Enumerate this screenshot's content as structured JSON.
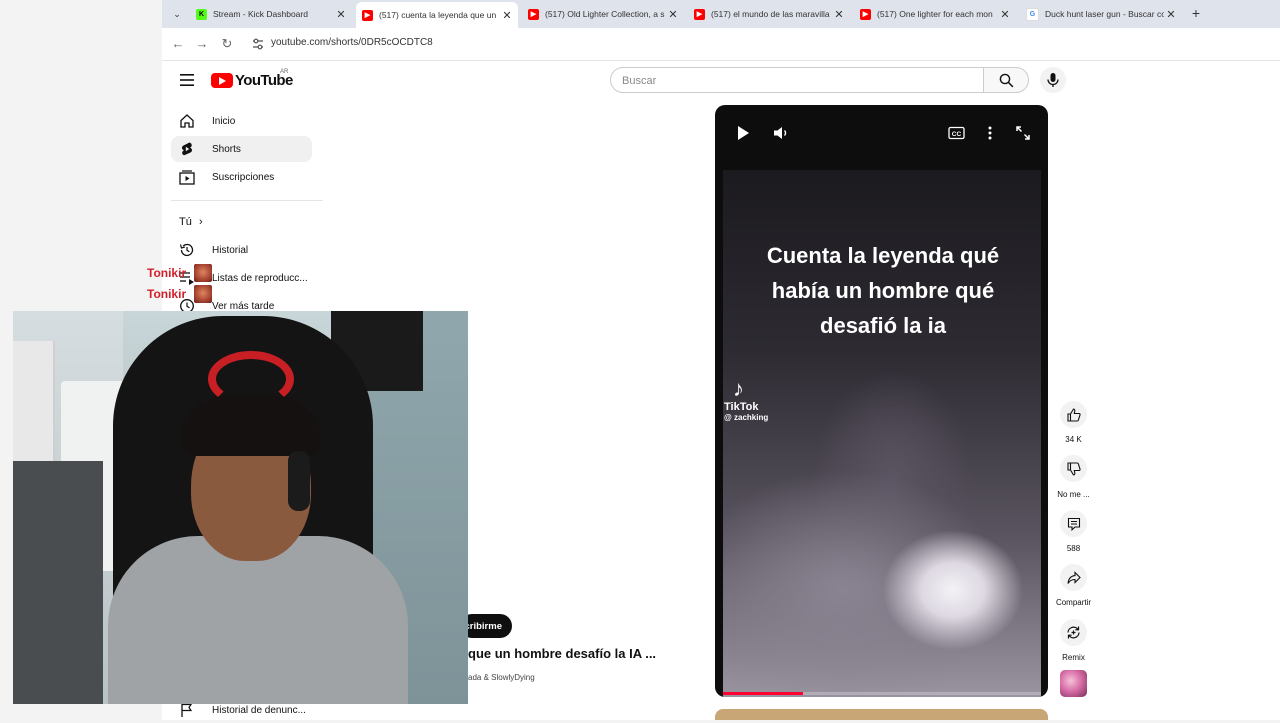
{
  "browser": {
    "tabs": [
      {
        "title": "Stream - Kick Dashboard",
        "favicon": "kick-icon",
        "color": "#53fc18",
        "active": false
      },
      {
        "title": "(517) cuenta la leyenda que un",
        "favicon": "youtube-icon",
        "color": "#ff0000",
        "active": true
      },
      {
        "title": "(517) Old Lighter Collection, a s",
        "favicon": "youtube-icon",
        "color": "#ff0000",
        "active": false
      },
      {
        "title": "(517) el mundo de las maravilla",
        "favicon": "youtube-icon",
        "color": "#ff0000",
        "active": false
      },
      {
        "title": "(517) One lighter for each mon",
        "favicon": "youtube-icon",
        "color": "#ff0000",
        "active": false
      },
      {
        "title": "Duck hunt laser gun - Buscar co",
        "favicon": "google-icon",
        "color": "#4285f4",
        "active": false
      }
    ],
    "url": "youtube.com/shorts/0DR5cOCDTC8"
  },
  "header": {
    "logo_text": "YouTube",
    "region": "AR",
    "search_placeholder": "Buscar"
  },
  "sidebar": {
    "items": [
      {
        "label": "Inicio",
        "icon": "home-icon",
        "selected": false
      },
      {
        "label": "Shorts",
        "icon": "shorts-icon",
        "selected": true
      },
      {
        "label": "Suscripciones",
        "icon": "subscriptions-icon",
        "selected": false
      }
    ],
    "you_label": "Tú",
    "you_items": [
      {
        "label": "Historial",
        "icon": "history-icon"
      },
      {
        "label": "Listas de reproducc...",
        "icon": "playlist-icon"
      },
      {
        "label": "Ver más tarde",
        "icon": "clock-icon"
      },
      {
        "label": "Historial de denunc...",
        "icon": "flag-icon"
      }
    ]
  },
  "short": {
    "caption": "Cuenta la leyenda qué había un hombre qué desafió la ia",
    "watermark_brand": "TikTok",
    "watermark_user": "@ zachking",
    "progress": 0.25,
    "subscribe_label": "cribirme",
    "title": "que un hombre desafío la IA ...",
    "sound": "ada & SlowlyDying"
  },
  "actions": [
    {
      "label": "34 K",
      "icon": "thumbs-up-icon"
    },
    {
      "label": "No me ...",
      "icon": "thumbs-down-icon"
    },
    {
      "label": "588",
      "icon": "comment-icon"
    },
    {
      "label": "Compartir",
      "icon": "share-icon"
    },
    {
      "label": "Remix",
      "icon": "remix-icon"
    }
  ],
  "overlay": {
    "chat_names": [
      "Tonikir",
      "Tonikir"
    ]
  }
}
